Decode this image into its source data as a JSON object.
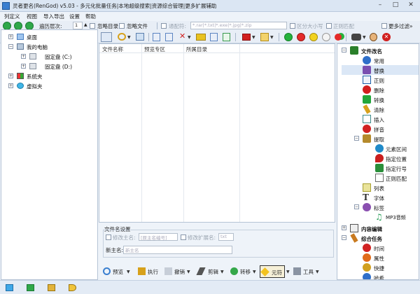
{
  "window": {
    "title": "灵者更名(RenGod) v5.03 - 多元化批量任务|本地超级搜索|资源综合管理|更多扩展辅助",
    "min": "–",
    "max": "□",
    "close": "✕"
  },
  "menu": [
    "列定义",
    "视图",
    "导入导出",
    "设置",
    "帮助"
  ],
  "toolbar": {
    "depth_label": "遍历层次:",
    "depth_value": "1",
    "ignore_dirs": "忽略目录",
    "ignore_files": "忽略文件",
    "filter_label": "通配符:",
    "filter_value": "*.rar|*.txt|*.exe|*.jpg|*.zip",
    "case_label": "区分大小写",
    "regex_label": "正则匹配",
    "more_filter": "更多过滤»"
  },
  "tree": [
    {
      "label": "桌面",
      "level": 0,
      "expander": "+",
      "icon": "desktop-icon"
    },
    {
      "label": "我的电脑",
      "level": 0,
      "expander": "−",
      "icon": "computer-icon"
    },
    {
      "label": "固定盘 (C:)",
      "level": 1,
      "expander": "+",
      "icon": "drive-icon"
    },
    {
      "label": "固定盘 (D:)",
      "level": 1,
      "expander": "+",
      "icon": "drive-icon"
    },
    {
      "label": "系统夹",
      "level": 0,
      "expander": "+",
      "icon": "system-folder-icon"
    },
    {
      "label": "虚拟夹",
      "level": 0,
      "expander": "+",
      "icon": "virtual-folder-icon"
    }
  ],
  "list": {
    "columns": [
      "文件名称",
      "预览专区",
      "所属目录"
    ]
  },
  "settings": {
    "group": "文件名设置",
    "main_name_label": "修改主名:",
    "main_name_value": "[原主名编号]",
    "ext_label": "修改扩展名:",
    "ext_value": "txt",
    "new_name_label": "新主名:",
    "new_name_placeholder": "新主名"
  },
  "bottom": [
    {
      "label": "预览",
      "icon": "preview-icon"
    },
    {
      "label": "执行",
      "icon": "execute-icon"
    },
    {
      "label": "撤销",
      "icon": "undo-icon"
    },
    {
      "label": "剪辑",
      "icon": "clip-icon"
    },
    {
      "label": "转移",
      "icon": "transfer-icon"
    },
    {
      "label": "元符",
      "icon": "symbol-icon"
    },
    {
      "label": "工具",
      "icon": "tools-icon"
    }
  ],
  "tasks": [
    {
      "label": "文件改名",
      "level": 0,
      "expander": "−",
      "bold": true,
      "icon": "rename-icon",
      "color": "#2a7f2a"
    },
    {
      "label": "常用",
      "level": 1,
      "icon": "info-icon",
      "color": "#2f6fc9"
    },
    {
      "label": "替换",
      "level": 1,
      "icon": "replace-icon",
      "color": "#7a4fb0"
    },
    {
      "label": "正则",
      "level": 1,
      "icon": "regex-icon",
      "color": "#1b5fa8"
    },
    {
      "label": "删除",
      "level": 1,
      "icon": "delete-icon",
      "color": "#d11f1f"
    },
    {
      "label": "转换",
      "level": 1,
      "icon": "convert-icon",
      "color": "#22a63a"
    },
    {
      "label": "清除",
      "level": 1,
      "icon": "clear-icon",
      "color": "#d7a11b"
    },
    {
      "label": "插入",
      "level": 1,
      "icon": "insert-icon",
      "color": "#3c8a8a"
    },
    {
      "label": "拼音",
      "level": 1,
      "icon": "pinyin-icon",
      "color": "#d12222"
    },
    {
      "label": "提取",
      "level": 1,
      "expander": "−",
      "icon": "extract-icon",
      "color": "#b58a2c"
    },
    {
      "label": "元素区间",
      "level": 2,
      "icon": "element-range-icon",
      "color": "#1f8ac9"
    },
    {
      "label": "指定位置",
      "level": 2,
      "icon": "position-icon",
      "color": "#c91f1f"
    },
    {
      "label": "指定行号",
      "level": 2,
      "icon": "line-number-icon",
      "color": "#2a8f3a"
    },
    {
      "label": "正则匹配",
      "level": 2,
      "icon": "regex-match-icon",
      "color": "#6b6b6b"
    },
    {
      "label": "列表",
      "level": 1,
      "icon": "list-icon",
      "color": "#a8a030"
    },
    {
      "label": "字体",
      "level": 1,
      "icon": "font-icon",
      "color": "#333333"
    },
    {
      "label": "标签",
      "level": 1,
      "expander": "−",
      "icon": "tag-icon",
      "color": "#8a4fb0"
    },
    {
      "label": "MP3音频",
      "level": 2,
      "icon": "mp3-icon",
      "color": "#2a9f5a"
    },
    {
      "label": "内容编辑",
      "level": 0,
      "expander": "+",
      "bold": true,
      "icon": "content-edit-icon",
      "color": "#555555"
    },
    {
      "label": "综合任务",
      "level": 0,
      "expander": "−",
      "bold": true,
      "icon": "integrated-task-icon",
      "color": "#c97a1f"
    },
    {
      "label": "时间",
      "level": 1,
      "icon": "time-icon",
      "color": "#d12222"
    },
    {
      "label": "属性",
      "level": 1,
      "icon": "attribute-icon",
      "color": "#e06b1a"
    },
    {
      "label": "快捷",
      "level": 1,
      "icon": "shortcut-icon",
      "color": "#d1a01f"
    },
    {
      "label": "哈希",
      "level": 1,
      "icon": "hash-icon",
      "color": "#2f6fc9"
    }
  ],
  "colors": {
    "accent": "#3a7fd0",
    "panel": "#eef3f9",
    "border": "#b5c3d5"
  }
}
